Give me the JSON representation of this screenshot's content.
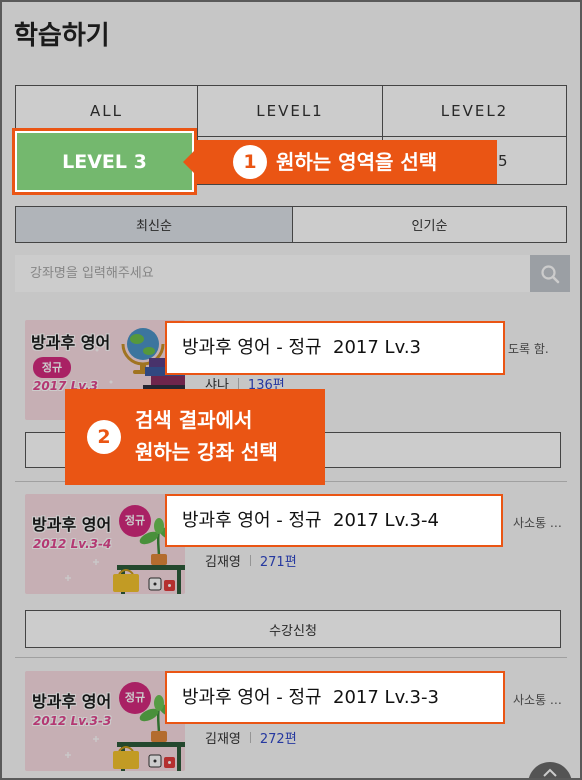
{
  "page": {
    "title": "학습하기"
  },
  "level_tabs": [
    {
      "label": "ALL"
    },
    {
      "label": "LEVEL1"
    },
    {
      "label": "LEVEL2"
    },
    {},
    {},
    {
      "label": "5"
    }
  ],
  "sort_tabs": [
    {
      "label": "최신순",
      "selected": true
    },
    {
      "label": "인기순",
      "selected": false
    }
  ],
  "search": {
    "placeholder": "강좌명을 입력해주세요",
    "icon": "search-icon"
  },
  "enroll_label": "수강신청",
  "courses": [
    {
      "title": "방과후 영어 - 정규  2017 Lv.3",
      "thumb": {
        "title": "방과후 영어",
        "badge": "정규",
        "subtitle": "2017 Lv.3"
      },
      "description": "도록 함.",
      "author": "샤나",
      "lesson_count": "136편"
    },
    {
      "title": "방과후 영어 - 정규  2017 Lv.3-4",
      "thumb": {
        "title": "방과후 영어",
        "badge": "정규",
        "subtitle": "2012 Lv.3-4"
      },
      "description": "사소통 …",
      "author": "김재영",
      "lesson_count": "271편"
    },
    {
      "title": "방과후 영어 - 정규  2017 Lv.3-3",
      "thumb": {
        "title": "방과후 영어",
        "badge": "정규",
        "subtitle": "2012 Lv.3-3"
      },
      "description": "사소통 …",
      "author": "김재영",
      "lesson_count": "272편"
    }
  ],
  "guide": {
    "highlight_label": "LEVEL 3",
    "step1": {
      "number": "1",
      "text": "원하는 영역을 선택"
    },
    "step2": {
      "number": "2",
      "lines": [
        "검색 결과에서",
        "원하는 강좌 선택"
      ]
    }
  },
  "icons": {
    "search": "search-icon",
    "scroll_top": "chevron-up-icon"
  },
  "colors": {
    "accent": "#ea5514",
    "highlight": "#74b86e",
    "count": "#3048c8",
    "badge": "#d42a7e",
    "thumb_bg": "#f8dbe1"
  }
}
